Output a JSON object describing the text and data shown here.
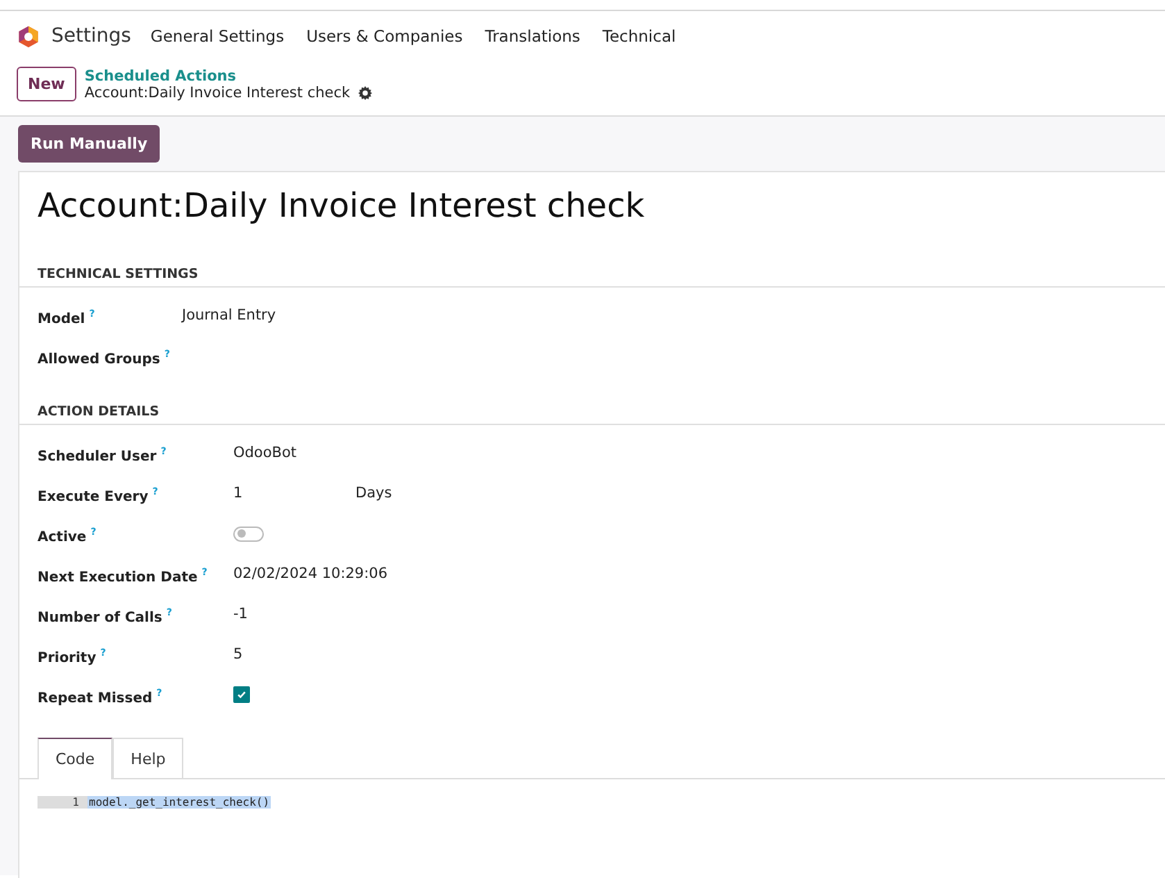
{
  "navbar": {
    "app": "Settings",
    "menu": [
      "General Settings",
      "Users & Companies",
      "Translations",
      "Technical"
    ]
  },
  "control_panel": {
    "new_button": "New",
    "breadcrumb": "Scheduled Actions",
    "record": "Account:Daily Invoice Interest check"
  },
  "actions": [
    "Run Manually"
  ],
  "form": {
    "title": "Account:Daily Invoice Interest check",
    "sections": [
      {
        "heading": "TECHNICAL SETTINGS",
        "fields": [
          {
            "kind": "text",
            "label": "Model",
            "help": "?",
            "value": "Journal Entry"
          },
          {
            "kind": "text",
            "label": "Allowed Groups",
            "help": "?"
          }
        ]
      },
      {
        "heading": "ACTION DETAILS",
        "fields": [
          {
            "kind": "text",
            "label": "Scheduler User",
            "help": "?",
            "value": "OdooBot"
          },
          {
            "kind": "duration",
            "label": "Execute Every",
            "help": "?",
            "value": "1",
            "unit": "Days"
          },
          {
            "kind": "toggle",
            "label": "Active",
            "help": "?",
            "on": false
          },
          {
            "kind": "text",
            "label": "Next Execution Date",
            "help": "?",
            "value": "02/02/2024 10:29:06"
          },
          {
            "kind": "text",
            "label": "Number of Calls",
            "help": "?",
            "value": "-1"
          },
          {
            "kind": "text",
            "label": "Priority",
            "help": "?",
            "value": "5"
          },
          {
            "kind": "checkbox",
            "label": "Repeat Missed",
            "help": "?",
            "checked": true
          }
        ]
      }
    ],
    "tabs": [
      {
        "label": "Code",
        "selected": true
      },
      {
        "label": "Help",
        "selected": false
      }
    ],
    "code": [
      {
        "line_number": "1",
        "text": "model._get_interest_check()"
      }
    ]
  }
}
